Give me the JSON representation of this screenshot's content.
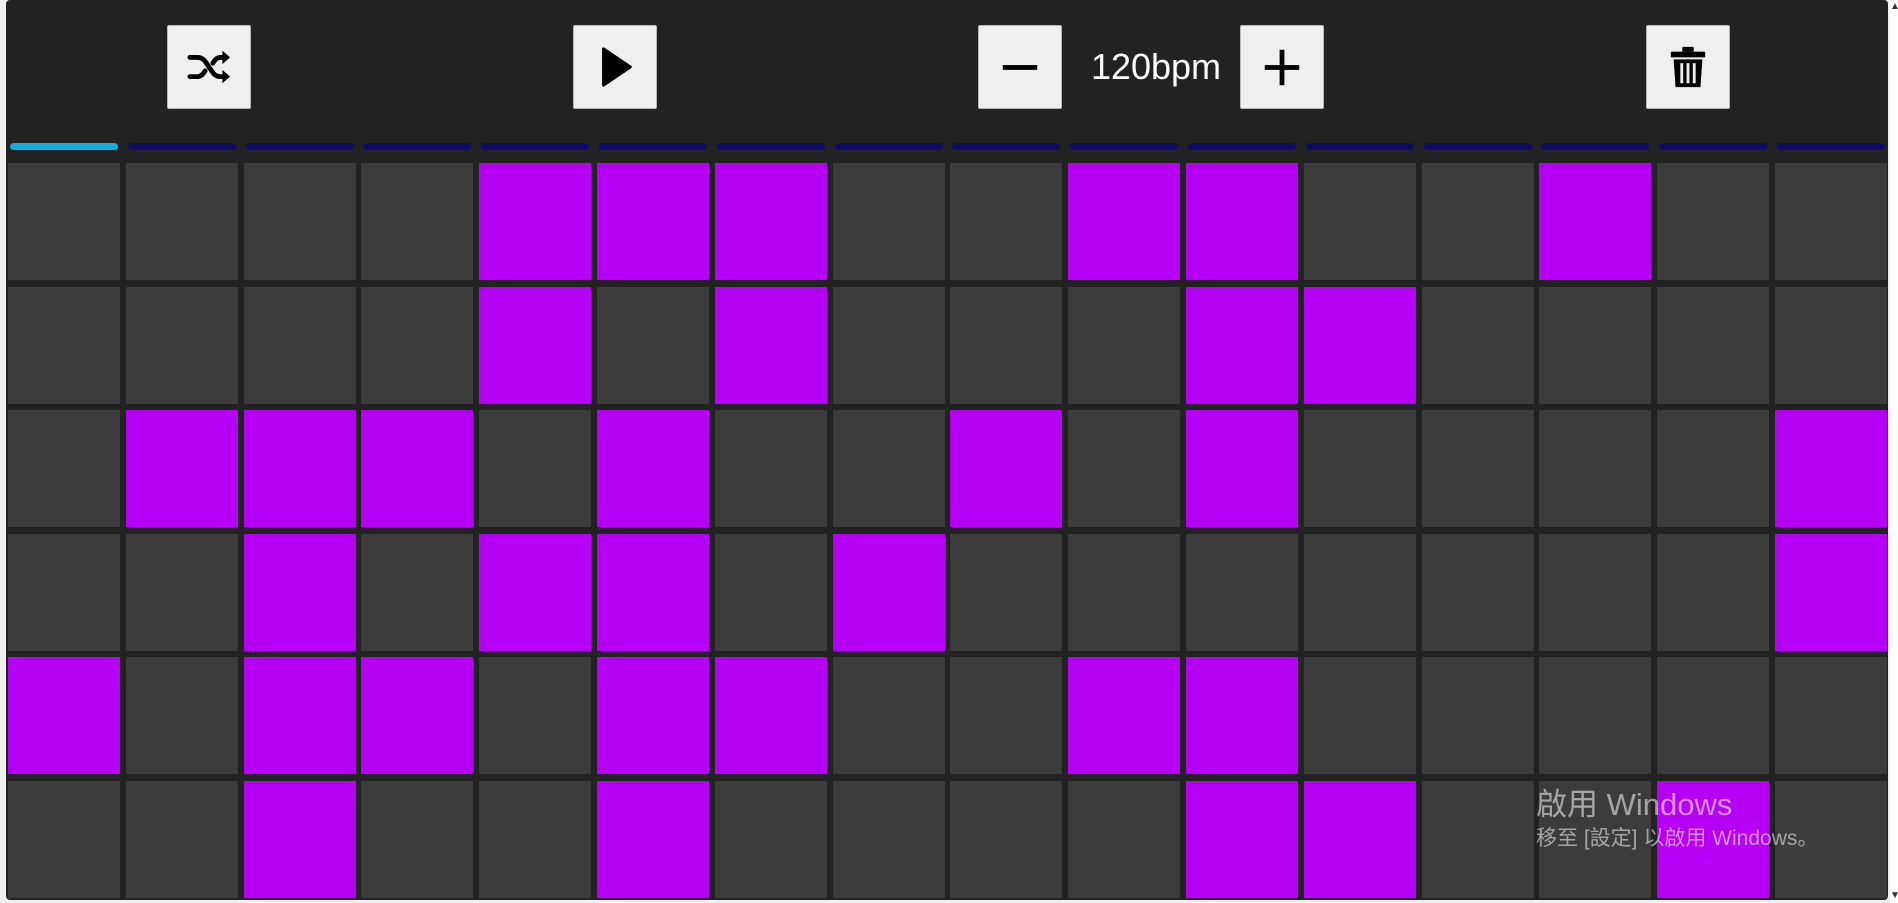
{
  "toolbar": {
    "shuffle_icon": "shuffle-icon",
    "play_icon": "play-icon",
    "decrease_icon": "minus-icon",
    "tempo_label": "120bpm",
    "increase_icon": "plus-icon",
    "clear_icon": "trash-icon"
  },
  "sequencer": {
    "steps": 16,
    "current_step": 1,
    "rows": [
      [
        0,
        0,
        0,
        0,
        1,
        1,
        1,
        0,
        0,
        1,
        1,
        0,
        0,
        1,
        0,
        0
      ],
      [
        0,
        0,
        0,
        0,
        1,
        0,
        1,
        0,
        0,
        0,
        1,
        1,
        0,
        0,
        0,
        0
      ],
      [
        0,
        1,
        1,
        1,
        0,
        1,
        0,
        0,
        1,
        0,
        1,
        0,
        0,
        0,
        0,
        1
      ],
      [
        0,
        0,
        1,
        0,
        1,
        1,
        0,
        1,
        0,
        0,
        0,
        0,
        0,
        0,
        0,
        1
      ],
      [
        1,
        0,
        1,
        1,
        0,
        1,
        1,
        0,
        0,
        1,
        1,
        0,
        0,
        0,
        0,
        0
      ],
      [
        0,
        0,
        1,
        0,
        0,
        1,
        0,
        0,
        0,
        0,
        1,
        1,
        0,
        0,
        1,
        0
      ]
    ]
  },
  "colors": {
    "background": "#222222",
    "cell_off": "#3c3c3c",
    "cell_on": "#b600f6",
    "step_indicator": "#0e0a66",
    "step_indicator_active": "#10b0e0"
  },
  "watermark": {
    "title": "啟用 Windows",
    "subtitle": "移至 [設定] 以啟用 Windows。"
  }
}
